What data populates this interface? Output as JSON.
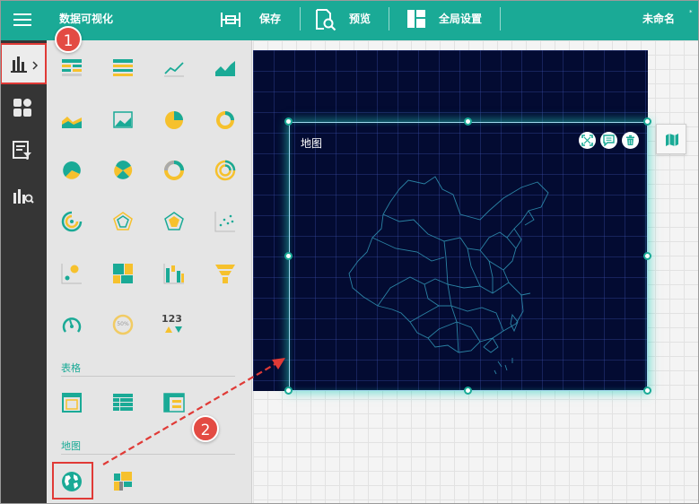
{
  "app": {
    "title": "数据可视化",
    "doc_name": "未命名"
  },
  "toolbar": {
    "save_label": "保存",
    "preview_label": "预览",
    "global_settings_label": "全局设置"
  },
  "rail": {
    "items": [
      "chart-icon",
      "widgets-icon",
      "filter-icon",
      "data-icon"
    ],
    "active_index": 0
  },
  "palette": {
    "chart_icons": [
      "bar-table",
      "bar-table-2",
      "line",
      "area",
      "area-combo",
      "area-image",
      "pie",
      "ring",
      "pie-sectors",
      "rose-pie",
      "rose-ring",
      "progress-ring",
      "radial-bar",
      "radar",
      "radar-fill",
      "scatter",
      "bubble",
      "treemap",
      "waterfall",
      "funnel",
      "gauge",
      "liquid-gauge",
      "number-indicator"
    ],
    "gauge_label": "50%",
    "indicator_label": "123",
    "sections": [
      {
        "label": "表格",
        "icons": [
          "table-frame",
          "table-list",
          "table-cross"
        ]
      },
      {
        "label": "地图",
        "icons": [
          "globe",
          "color-map"
        ]
      }
    ]
  },
  "canvas": {
    "widget_title": "地图",
    "widget_buttons": [
      "fullscreen-icon",
      "comment-icon",
      "delete-icon"
    ]
  },
  "annotations": {
    "step1": "1",
    "step2": "2"
  },
  "colors": {
    "brand": "#1aaa96",
    "highlight": "#e03a36",
    "canvas_bg": "#030b32",
    "icon_teal": "#1aaa96",
    "icon_yellow": "#f6c12d"
  }
}
